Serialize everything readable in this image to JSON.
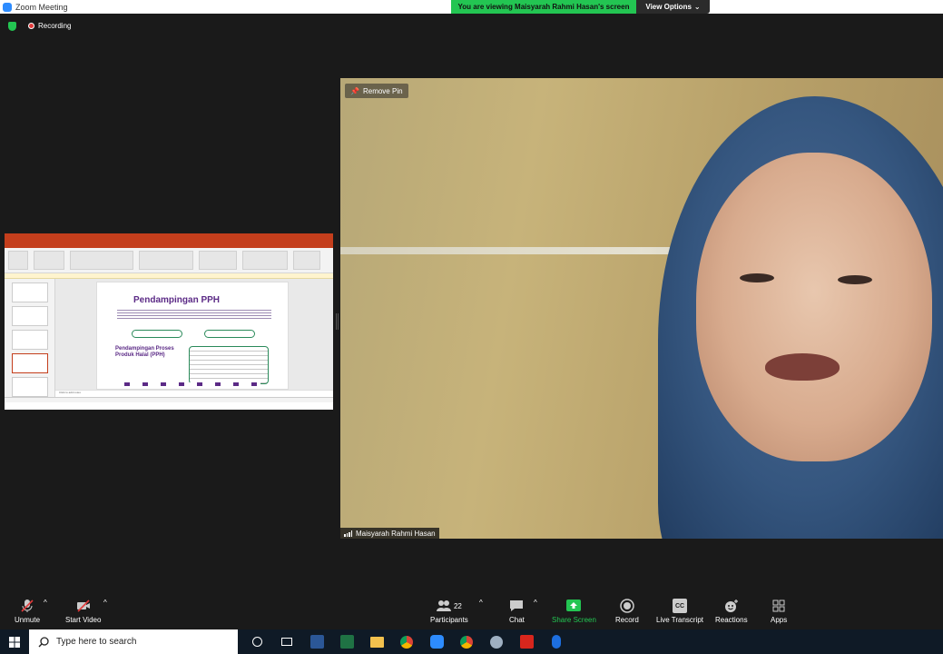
{
  "window": {
    "title": "Zoom Meeting"
  },
  "banner": {
    "viewing": "You are viewing Maisyarah Rahmi Hasan's screen",
    "view_options": "View Options"
  },
  "status": {
    "recording": "Recording"
  },
  "shared_screen": {
    "app": "PowerPoint",
    "slide_title": "Pendampingan PPH",
    "slide_subtitle": "Pendampingan Proses Produk Halal (PPH)",
    "notes_placeholder": "Click to add notes"
  },
  "video": {
    "remove_pin": "Remove Pin",
    "participant_name": "Maisyarah Rahmi Hasan"
  },
  "toolbar": {
    "unmute": "Unmute",
    "start_video": "Start Video",
    "participants": "Participants",
    "participants_count": "22",
    "chat": "Chat",
    "share_screen": "Share Screen",
    "record": "Record",
    "live_transcript": "Live Transcript",
    "cc": "CC",
    "reactions": "Reactions",
    "apps": "Apps"
  },
  "taskbar": {
    "search_placeholder": "Type here to search"
  },
  "colors": {
    "share_green": "#23c552",
    "ppt_red": "#c43e1c",
    "slide_purple": "#5b2a86"
  }
}
